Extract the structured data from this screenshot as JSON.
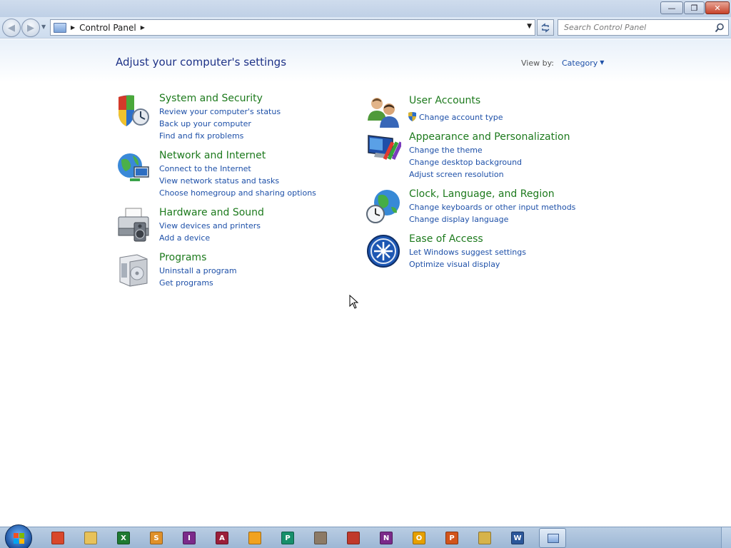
{
  "window": {
    "minimize_glyph": "—",
    "maximize_glyph": "❐",
    "close_glyph": "✕"
  },
  "nav": {
    "back_glyph": "◀",
    "forward_glyph": "▶"
  },
  "address": {
    "crumb": "Control Panel",
    "separator": "▶"
  },
  "search": {
    "placeholder": "Search Control Panel"
  },
  "main": {
    "title": "Adjust your computer's settings",
    "view_by_label": "View by:",
    "view_by_value": "Category"
  },
  "categories": {
    "system": {
      "heading": "System and Security",
      "links": [
        "Review your computer's status",
        "Back up your computer",
        "Find and fix problems"
      ]
    },
    "network": {
      "heading": "Network and Internet",
      "links": [
        "Connect to the Internet",
        "View network status and tasks",
        "Choose homegroup and sharing options"
      ]
    },
    "hardware": {
      "heading": "Hardware and Sound",
      "links": [
        "View devices and printers",
        "Add a device"
      ]
    },
    "programs": {
      "heading": "Programs",
      "links": [
        "Uninstall a program",
        "Get programs"
      ]
    },
    "users": {
      "heading": "User Accounts",
      "links": [
        "Change account type"
      ]
    },
    "appearance": {
      "heading": "Appearance and Personalization",
      "links": [
        "Change the theme",
        "Change desktop background",
        "Adjust screen resolution"
      ]
    },
    "clock": {
      "heading": "Clock, Language, and Region",
      "links": [
        "Change keyboards or other input methods",
        "Change display language"
      ]
    },
    "ease": {
      "heading": "Ease of Access",
      "links": [
        "Let Windows suggest settings",
        "Optimize visual display"
      ]
    }
  },
  "taskbar": {
    "apps": [
      {
        "name": "firefox",
        "letter": "",
        "color": "#d9472b"
      },
      {
        "name": "explorer",
        "letter": "",
        "color": "#e8c25a"
      },
      {
        "name": "excel",
        "letter": "X",
        "color": "#1f7a32"
      },
      {
        "name": "sharepoint",
        "letter": "S",
        "color": "#e0912a"
      },
      {
        "name": "infopath",
        "letter": "I",
        "color": "#7b2a8a"
      },
      {
        "name": "access",
        "letter": "A",
        "color": "#9b1f3a"
      },
      {
        "name": "app-orange",
        "letter": "",
        "color": "#f1a21f"
      },
      {
        "name": "publisher",
        "letter": "P",
        "color": "#168f6b"
      },
      {
        "name": "app-portrait",
        "letter": "",
        "color": "#8c7a66"
      },
      {
        "name": "app-chart",
        "letter": "",
        "color": "#c0392b"
      },
      {
        "name": "onenote",
        "letter": "N",
        "color": "#7b2a8a"
      },
      {
        "name": "outlook",
        "letter": "O",
        "color": "#e6a000"
      },
      {
        "name": "powerpoint",
        "letter": "P",
        "color": "#d2541b"
      },
      {
        "name": "app-tools",
        "letter": "",
        "color": "#d6b34a"
      },
      {
        "name": "word",
        "letter": "W",
        "color": "#2b579a"
      }
    ]
  }
}
